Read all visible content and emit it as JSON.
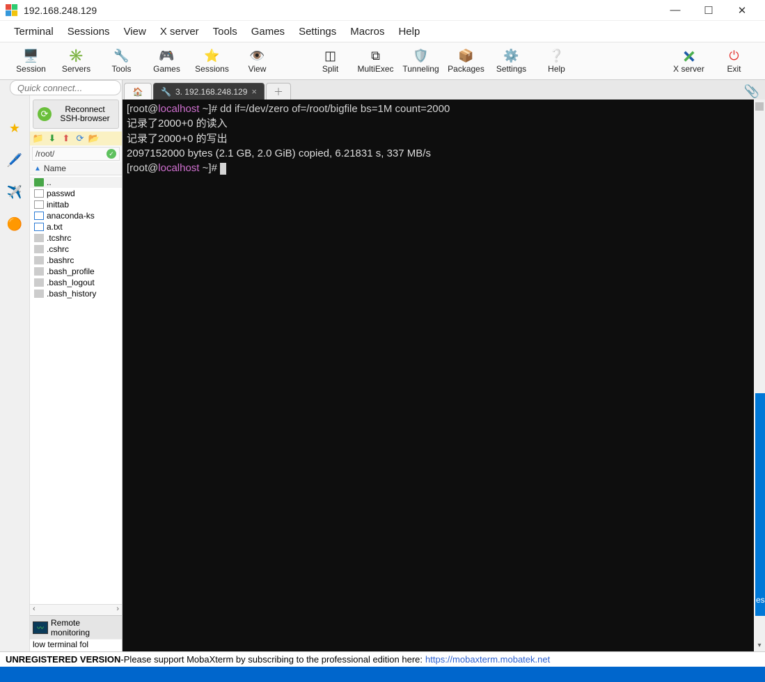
{
  "window": {
    "title": "192.168.248.129"
  },
  "menubar": [
    "Terminal",
    "Sessions",
    "View",
    "X server",
    "Tools",
    "Games",
    "Settings",
    "Macros",
    "Help"
  ],
  "toolbar": [
    {
      "label": "Session",
      "icon": "🖥️"
    },
    {
      "label": "Servers",
      "icon": "✳️"
    },
    {
      "label": "Tools",
      "icon": "🔧"
    },
    {
      "label": "Games",
      "icon": "🎮"
    },
    {
      "label": "Sessions",
      "icon": "⭐"
    },
    {
      "label": "View",
      "icon": "👁️"
    },
    {
      "label": "Split",
      "icon": "◫"
    },
    {
      "label": "MultiExec",
      "icon": "⧉"
    },
    {
      "label": "Tunneling",
      "icon": "🛡️"
    },
    {
      "label": "Packages",
      "icon": "📦"
    },
    {
      "label": "Settings",
      "icon": "⚙️"
    },
    {
      "label": "Help",
      "icon": "❔"
    }
  ],
  "toolbar_right": [
    {
      "label": "X server",
      "icon": "✕"
    },
    {
      "label": "Exit",
      "icon": "⏻"
    }
  ],
  "quickconnect_placeholder": "Quick connect...",
  "reconnect": {
    "line1": "Reconnect",
    "line2": "SSH-browser"
  },
  "sidebar_path": "/root/",
  "file_header": "Name",
  "files": [
    {
      "name": "..",
      "type": "folder",
      "sel": true
    },
    {
      "name": "passwd",
      "type": "file"
    },
    {
      "name": "inittab",
      "type": "file"
    },
    {
      "name": "anaconda-ks",
      "type": "filetxt"
    },
    {
      "name": "a.txt",
      "type": "filetxt"
    },
    {
      "name": ".tcshrc",
      "type": "hidden"
    },
    {
      "name": ".cshrc",
      "type": "hidden"
    },
    {
      "name": ".bashrc",
      "type": "hidden"
    },
    {
      "name": ".bash_profile",
      "type": "hidden"
    },
    {
      "name": ".bash_logout",
      "type": "hidden"
    },
    {
      "name": ".bash_history",
      "type": "hidden"
    }
  ],
  "remote_mon": {
    "line1": "Remote",
    "line2": "monitoring"
  },
  "low_terminal": "low terminal fol",
  "tabs": {
    "active_label": "3. 192.168.248.129"
  },
  "terminal": {
    "prompt_open": "[",
    "user": "root",
    "at": "@",
    "host": "localhost",
    "pathloc": " ~",
    "prompt_close": "]# ",
    "cmd": "dd if=/dev/zero of=/root/bigfile bs=1M count=2000",
    "line2": "记录了2000+0 的读入",
    "line3": "记录了2000+0 的写出",
    "line4": "2097152000 bytes (2.1 GB, 2.0 GiB) copied, 6.21831 s, 337 MB/s"
  },
  "footer": {
    "bold": "UNREGISTERED VERSION",
    "sep": " - ",
    "text": "Please support MobaXterm by subscribing to the professional edition here: ",
    "link": "https://mobaxterm.mobatek.net"
  },
  "blueslice_text": "es"
}
